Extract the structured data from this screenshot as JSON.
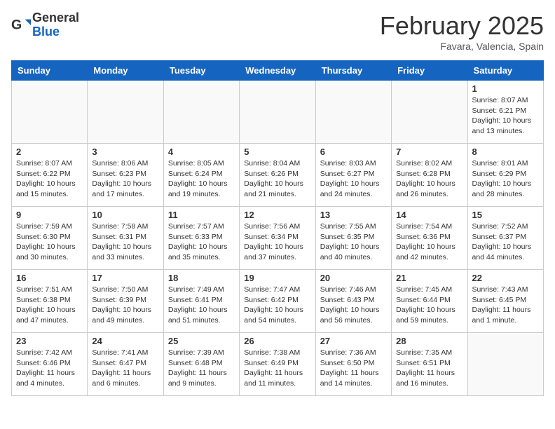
{
  "logo": {
    "general": "General",
    "blue": "Blue"
  },
  "header": {
    "month": "February 2025",
    "location": "Favara, Valencia, Spain"
  },
  "weekdays": [
    "Sunday",
    "Monday",
    "Tuesday",
    "Wednesday",
    "Thursday",
    "Friday",
    "Saturday"
  ],
  "weeks": [
    [
      {
        "day": "",
        "info": ""
      },
      {
        "day": "",
        "info": ""
      },
      {
        "day": "",
        "info": ""
      },
      {
        "day": "",
        "info": ""
      },
      {
        "day": "",
        "info": ""
      },
      {
        "day": "",
        "info": ""
      },
      {
        "day": "1",
        "info": "Sunrise: 8:07 AM\nSunset: 6:21 PM\nDaylight: 10 hours\nand 13 minutes."
      }
    ],
    [
      {
        "day": "2",
        "info": "Sunrise: 8:07 AM\nSunset: 6:22 PM\nDaylight: 10 hours\nand 15 minutes."
      },
      {
        "day": "3",
        "info": "Sunrise: 8:06 AM\nSunset: 6:23 PM\nDaylight: 10 hours\nand 17 minutes."
      },
      {
        "day": "4",
        "info": "Sunrise: 8:05 AM\nSunset: 6:24 PM\nDaylight: 10 hours\nand 19 minutes."
      },
      {
        "day": "5",
        "info": "Sunrise: 8:04 AM\nSunset: 6:26 PM\nDaylight: 10 hours\nand 21 minutes."
      },
      {
        "day": "6",
        "info": "Sunrise: 8:03 AM\nSunset: 6:27 PM\nDaylight: 10 hours\nand 24 minutes."
      },
      {
        "day": "7",
        "info": "Sunrise: 8:02 AM\nSunset: 6:28 PM\nDaylight: 10 hours\nand 26 minutes."
      },
      {
        "day": "8",
        "info": "Sunrise: 8:01 AM\nSunset: 6:29 PM\nDaylight: 10 hours\nand 28 minutes."
      }
    ],
    [
      {
        "day": "9",
        "info": "Sunrise: 7:59 AM\nSunset: 6:30 PM\nDaylight: 10 hours\nand 30 minutes."
      },
      {
        "day": "10",
        "info": "Sunrise: 7:58 AM\nSunset: 6:31 PM\nDaylight: 10 hours\nand 33 minutes."
      },
      {
        "day": "11",
        "info": "Sunrise: 7:57 AM\nSunset: 6:33 PM\nDaylight: 10 hours\nand 35 minutes."
      },
      {
        "day": "12",
        "info": "Sunrise: 7:56 AM\nSunset: 6:34 PM\nDaylight: 10 hours\nand 37 minutes."
      },
      {
        "day": "13",
        "info": "Sunrise: 7:55 AM\nSunset: 6:35 PM\nDaylight: 10 hours\nand 40 minutes."
      },
      {
        "day": "14",
        "info": "Sunrise: 7:54 AM\nSunset: 6:36 PM\nDaylight: 10 hours\nand 42 minutes."
      },
      {
        "day": "15",
        "info": "Sunrise: 7:52 AM\nSunset: 6:37 PM\nDaylight: 10 hours\nand 44 minutes."
      }
    ],
    [
      {
        "day": "16",
        "info": "Sunrise: 7:51 AM\nSunset: 6:38 PM\nDaylight: 10 hours\nand 47 minutes."
      },
      {
        "day": "17",
        "info": "Sunrise: 7:50 AM\nSunset: 6:39 PM\nDaylight: 10 hours\nand 49 minutes."
      },
      {
        "day": "18",
        "info": "Sunrise: 7:49 AM\nSunset: 6:41 PM\nDaylight: 10 hours\nand 51 minutes."
      },
      {
        "day": "19",
        "info": "Sunrise: 7:47 AM\nSunset: 6:42 PM\nDaylight: 10 hours\nand 54 minutes."
      },
      {
        "day": "20",
        "info": "Sunrise: 7:46 AM\nSunset: 6:43 PM\nDaylight: 10 hours\nand 56 minutes."
      },
      {
        "day": "21",
        "info": "Sunrise: 7:45 AM\nSunset: 6:44 PM\nDaylight: 10 hours\nand 59 minutes."
      },
      {
        "day": "22",
        "info": "Sunrise: 7:43 AM\nSunset: 6:45 PM\nDaylight: 11 hours\nand 1 minute."
      }
    ],
    [
      {
        "day": "23",
        "info": "Sunrise: 7:42 AM\nSunset: 6:46 PM\nDaylight: 11 hours\nand 4 minutes."
      },
      {
        "day": "24",
        "info": "Sunrise: 7:41 AM\nSunset: 6:47 PM\nDaylight: 11 hours\nand 6 minutes."
      },
      {
        "day": "25",
        "info": "Sunrise: 7:39 AM\nSunset: 6:48 PM\nDaylight: 11 hours\nand 9 minutes."
      },
      {
        "day": "26",
        "info": "Sunrise: 7:38 AM\nSunset: 6:49 PM\nDaylight: 11 hours\nand 11 minutes."
      },
      {
        "day": "27",
        "info": "Sunrise: 7:36 AM\nSunset: 6:50 PM\nDaylight: 11 hours\nand 14 minutes."
      },
      {
        "day": "28",
        "info": "Sunrise: 7:35 AM\nSunset: 6:51 PM\nDaylight: 11 hours\nand 16 minutes."
      },
      {
        "day": "",
        "info": ""
      }
    ]
  ]
}
